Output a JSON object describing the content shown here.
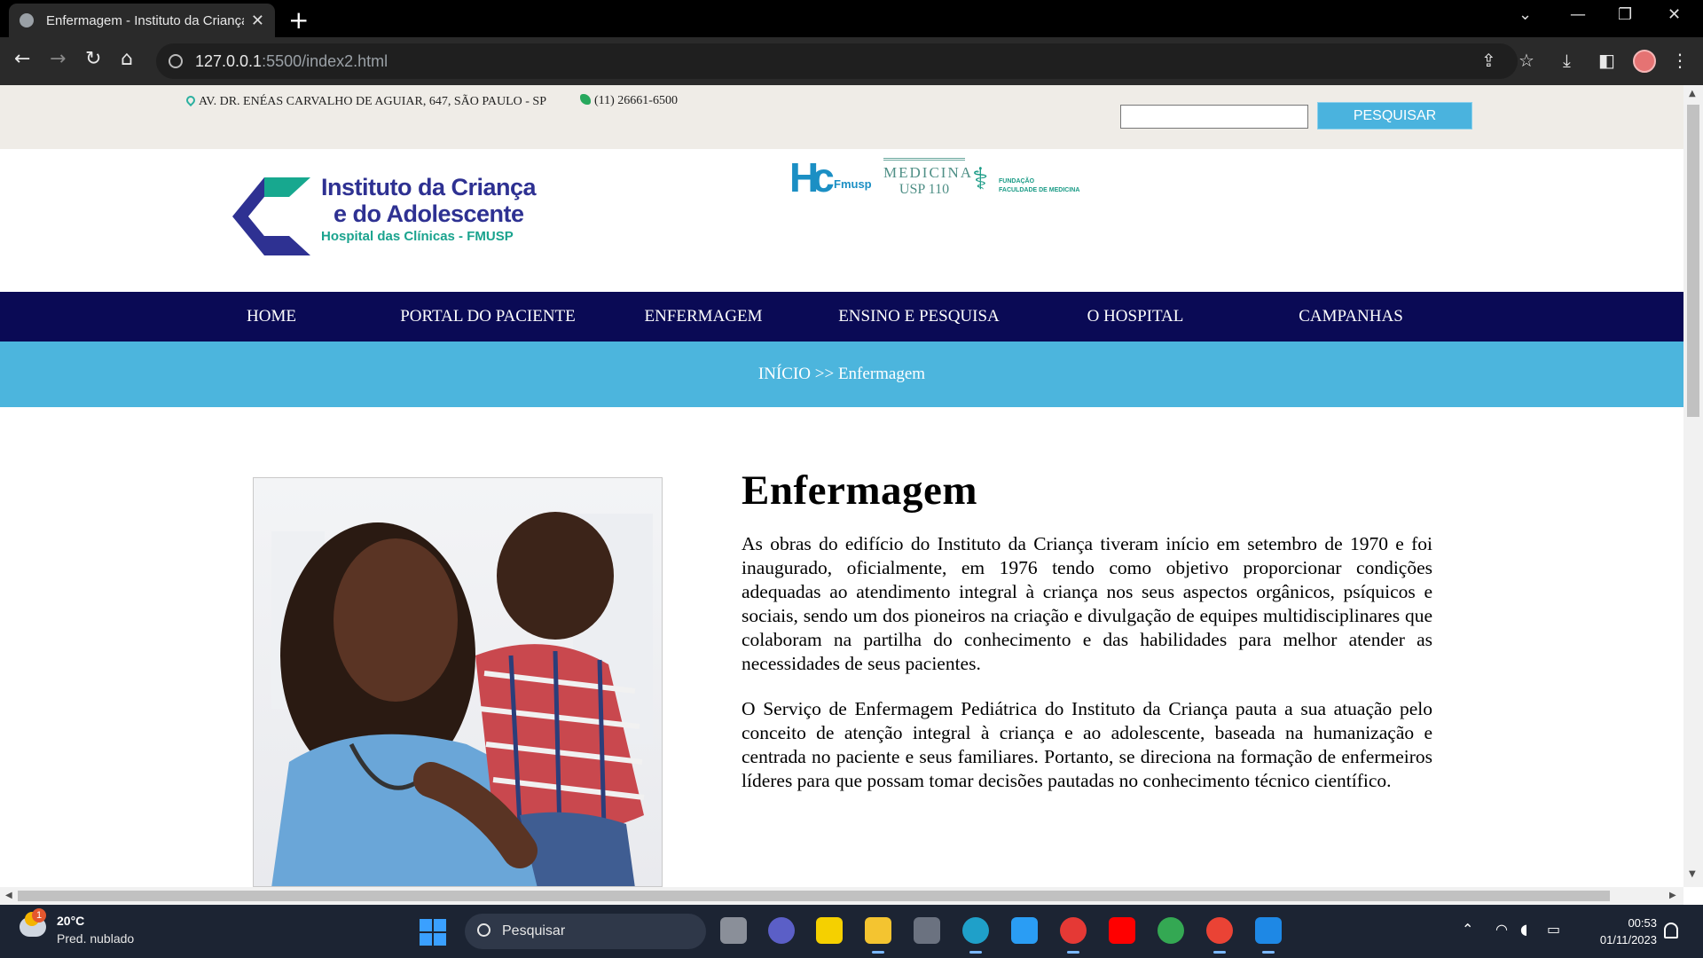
{
  "browser": {
    "tab_title": "Enfermagem - Instituto da Criança",
    "tab_close": "✕",
    "new_tab": "+",
    "url_host": "127.0.0.1",
    "url_rest": ":5500/index2.html"
  },
  "topbar": {
    "address": "AV. DR. ENÉAS CARVALHO DE AGUIAR, 647, SÃO PAULO - SP",
    "phone": "(11) 26661-6500",
    "search_placeholder": "",
    "search_button": "PESQUISAR"
  },
  "header": {
    "logo_line1": "Instituto da Criança",
    "logo_line2": "e do Adolescente",
    "logo_line3": "Hospital das Clínicas - FMUSP",
    "partners": {
      "hc_caption": "Fmusp",
      "medicina_title": "MEDICINA",
      "medicina_sub": "USP 110",
      "fundacao_line1": "FUNDAÇÃO",
      "fundacao_line2": "FACULDADE DE MEDICINA"
    }
  },
  "nav": {
    "items": [
      {
        "label": "HOME"
      },
      {
        "label": "PORTAL DO PACIENTE"
      },
      {
        "label": "ENFERMAGEM"
      },
      {
        "label": "ENSINO E PESQUISA"
      },
      {
        "label": "O HOSPITAL"
      },
      {
        "label": "CAMPANHAS"
      }
    ]
  },
  "breadcrumb": "INÍCIO >> Enfermagem",
  "main": {
    "title": "Enfermagem",
    "paragraph1": "As obras do edifício do Instituto da Criança tiveram início em setembro de 1970 e foi inaugurado, oficialmente, em 1976 tendo como objetivo proporcionar condições adequadas ao atendimento integral à criança nos seus aspectos orgânicos, psíquicos e sociais, sendo um dos pioneiros na criação e divulgação de equipes multidisciplinares que colaboram na partilha do conhecimento e das habilidades para melhor atender as necessidades de seus pacientes.",
    "paragraph2": "O Serviço de Enfermagem Pediátrica do Instituto da Criança pauta a sua atuação pelo conceito de atenção integral à criança e ao adolescente, baseada na humanização e centrada no paciente e seus familiares. Portanto, se direciona na formação de enfermeiros líderes para que possam tomar decisões pautadas no conhecimento técnico científico."
  },
  "taskbar": {
    "weather_temp": "20°C",
    "weather_desc": "Pred. nublado",
    "weather_badge": "1",
    "search_label": "Pesquisar",
    "time": "00:53",
    "date": "01/11/2023"
  }
}
